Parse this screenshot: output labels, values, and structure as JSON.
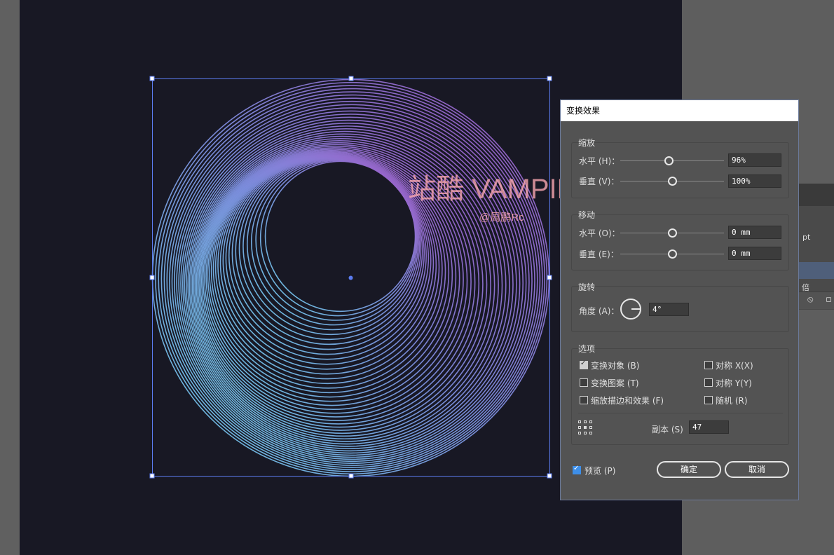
{
  "watermark": {
    "main": "站酷 VAMPIREE",
    "sub": "@周鹏Rc"
  },
  "bg_panel": {
    "unit": "pt",
    "label": "倍"
  },
  "dialog": {
    "title": "变换效果",
    "scale": {
      "label": "缩放",
      "horizontal": {
        "label": "水平 (H)：",
        "value": "96%",
        "level": 0.47
      },
      "vertical": {
        "label": "垂直 (V)：",
        "value": "100%",
        "level": 0.5
      }
    },
    "move": {
      "label": "移动",
      "horizontal": {
        "label": "水平 (O)：",
        "value": "0 mm",
        "level": 0.5
      },
      "vertical": {
        "label": "垂直 (E)：",
        "value": "0 mm",
        "level": 0.5
      }
    },
    "rotate": {
      "label": "旋转",
      "angle_label": "角度 (A)：",
      "angle_value": "4°"
    },
    "options": {
      "label": "选项",
      "transform_objects": {
        "label": "变换对象 (B)",
        "checked": true
      },
      "transform_patterns": {
        "label": "变换图案 (T)",
        "checked": false
      },
      "scale_strokes": {
        "label": "缩放描边和效果 (F)",
        "checked": false
      },
      "reflect_x": {
        "label": "对称 X(X)",
        "checked": false
      },
      "reflect_y": {
        "label": "对称 Y(Y)",
        "checked": false
      },
      "random": {
        "label": "随机 (R)",
        "checked": false
      },
      "copies_label": "副本 (S)",
      "copies_value": "47"
    },
    "preview": {
      "label": "预览 (P)",
      "checked": true
    },
    "ok_label": "确定",
    "cancel_label": "取消"
  },
  "colors": {
    "accent": "#3d8ee8",
    "selection": "#5b7cf0",
    "ring_cyan": "#6cc6ea",
    "ring_violet": "#9a5ec6",
    "artboard": "#181824"
  }
}
